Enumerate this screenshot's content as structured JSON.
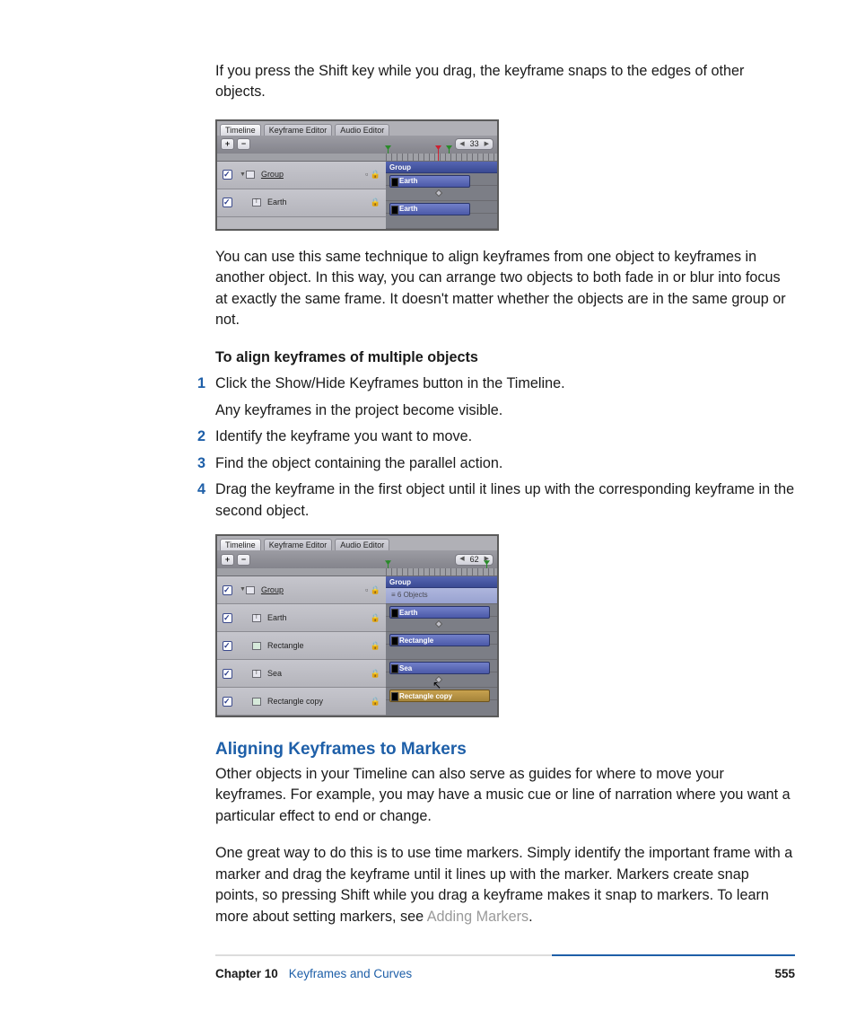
{
  "body": {
    "intro": "If you press the Shift key while you drag, the keyframe snaps to the edges of other objects.",
    "afterShot1": "You can use this same technique to align keyframes from one object to keyframes in another object. In this way, you can arrange two objects to both fade in or blur into focus at exactly the same frame. It doesn't matter whether the objects are in the same group or not.",
    "stepsHeading": "To align keyframes of multiple objects",
    "steps": [
      {
        "n": "1",
        "text": "Click the Show/Hide Keyframes button in the Timeline.",
        "note": "Any keyframes in the project become visible."
      },
      {
        "n": "2",
        "text": "Identify the keyframe you want to move."
      },
      {
        "n": "3",
        "text": "Find the object containing the parallel action."
      },
      {
        "n": "4",
        "text": "Drag the keyframe in the first object until it lines up with the corresponding keyframe in the second object."
      }
    ],
    "h2": "Aligning Keyframes to Markers",
    "p_markers_1": "Other objects in your Timeline can also serve as guides for where to move your keyframes. For example, you may have a music cue or line of narration where you want a particular effect to end or change.",
    "p_markers_2a": "One great way to do this is to use time markers. Simply identify the important frame with a marker and drag the keyframe until it lines up with the marker. Markers create snap points, so pressing Shift while you drag a keyframe makes it snap to markers. To learn more about setting markers, see ",
    "p_markers_2_link": "Adding Markers",
    "p_markers_2b": "."
  },
  "shot1": {
    "tabs": [
      "Timeline",
      "Keyframe Editor",
      "Audio Editor"
    ],
    "plus": "+",
    "minus": "−",
    "frame": "33",
    "groupHeader": "Group",
    "rows": [
      {
        "label": "Group",
        "isGroup": true
      },
      {
        "label": "Earth",
        "icon": "t"
      }
    ],
    "clips": [
      {
        "label": "Earth"
      },
      {
        "label": "Earth"
      }
    ]
  },
  "shot2": {
    "tabs": [
      "Timeline",
      "Keyframe Editor",
      "Audio Editor"
    ],
    "plus": "+",
    "minus": "−",
    "frame": "62",
    "groupHeader": "Group",
    "subHeader": "6 Objects",
    "rows": [
      {
        "label": "Group",
        "isGroup": true
      },
      {
        "label": "Earth",
        "icon": "t"
      },
      {
        "label": "Rectangle",
        "icon": "s"
      },
      {
        "label": "Sea",
        "icon": "t"
      },
      {
        "label": "Rectangle copy",
        "icon": "s"
      }
    ],
    "clips": [
      {
        "label": "Earth"
      },
      {
        "label": "Rectangle"
      },
      {
        "label": "Sea"
      },
      {
        "label": "Rectangle copy"
      }
    ]
  },
  "footer": {
    "chapter": "Chapter 10",
    "title": "Keyframes and Curves",
    "page": "555"
  }
}
